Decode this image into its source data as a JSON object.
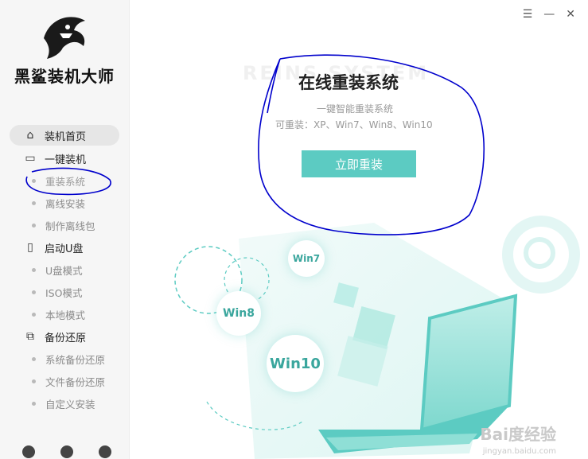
{
  "app": {
    "brand": "黑鲨装机大师",
    "window_controls": [
      "☰",
      "—",
      "✕"
    ]
  },
  "sidebar": {
    "items": [
      {
        "label": "装机首页",
        "icon": "home-icon"
      },
      {
        "label": "一键装机",
        "icon": "monitor-icon"
      },
      {
        "label": "重装系统"
      },
      {
        "label": "离线安装"
      },
      {
        "label": "制作离线包"
      },
      {
        "label": "启动U盘",
        "icon": "usb-icon"
      },
      {
        "label": "U盘模式"
      },
      {
        "label": "ISO模式"
      },
      {
        "label": "本地模式"
      },
      {
        "label": "备份还原",
        "icon": "backup-icon"
      },
      {
        "label": "系统备份还原"
      },
      {
        "label": "文件备份还原"
      },
      {
        "label": "自定义安装"
      }
    ]
  },
  "main": {
    "bg_text": "REINS    SYSTEM",
    "title": "在线重装系统",
    "subtitle": "一键智能重装系统",
    "support": "可重装：XP、Win7、Win8、Win10",
    "cta_label": "立即重装",
    "bubbles": [
      "Win7",
      "Win8",
      "Win10"
    ]
  },
  "watermark": {
    "main": "Bai度经验",
    "sub": "jingyan.baidu.com"
  },
  "colors": {
    "accent": "#5ccbc2",
    "annotation": "#0000cc"
  }
}
